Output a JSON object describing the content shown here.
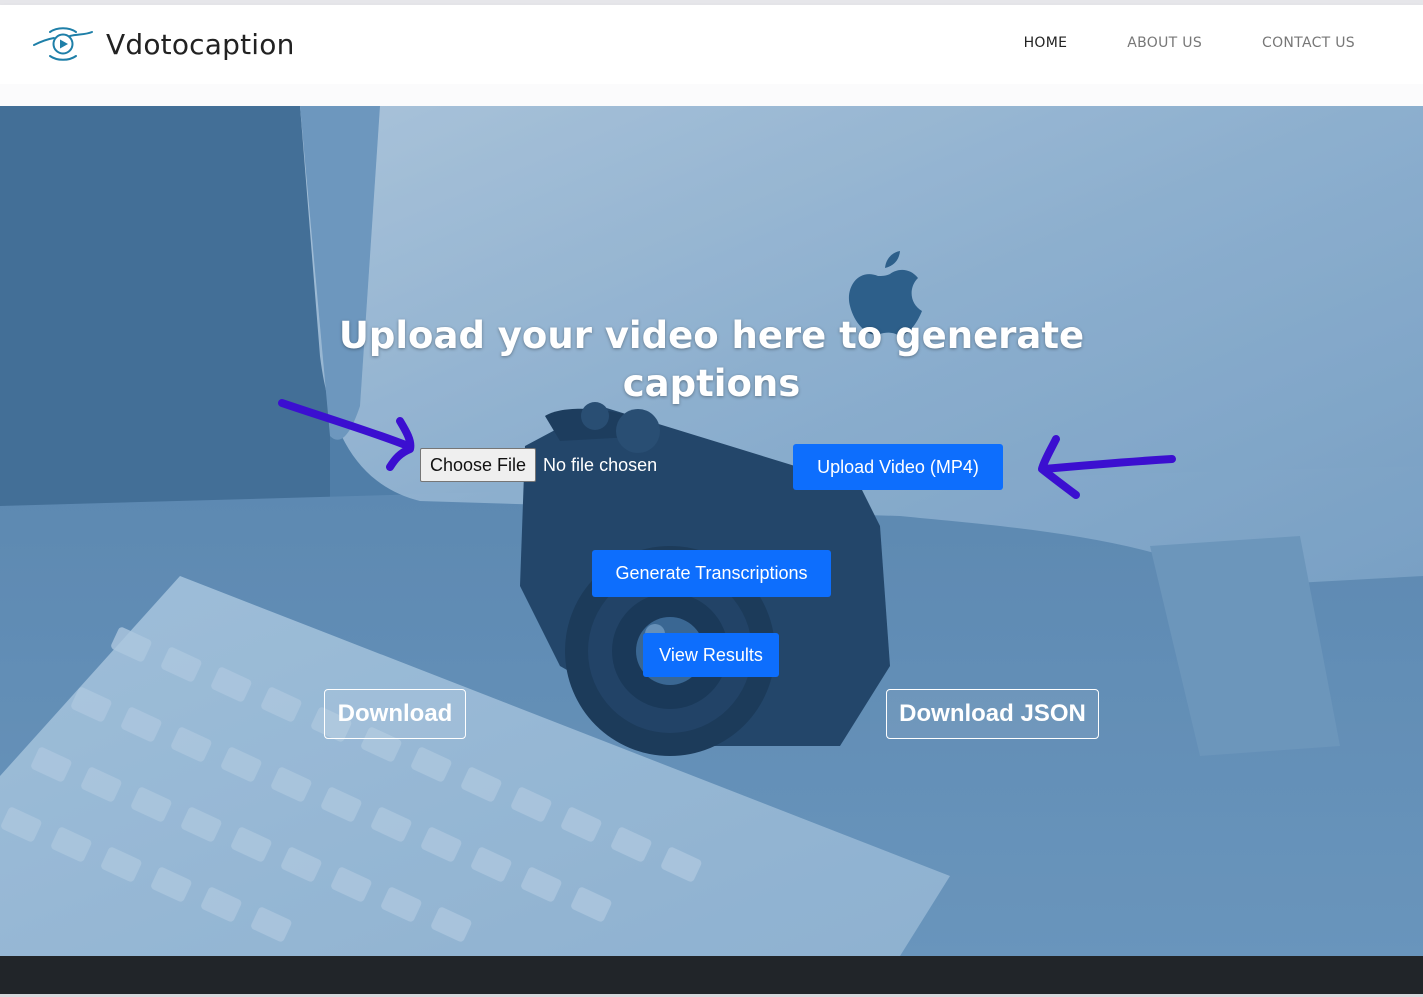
{
  "brand": {
    "name": "Vdotocaption",
    "logo_icon": "eye-play-logo-icon"
  },
  "nav": {
    "items": [
      {
        "label": "HOME",
        "active": true
      },
      {
        "label": "ABOUT US",
        "active": false
      },
      {
        "label": "CONTACT US",
        "active": false
      }
    ]
  },
  "hero": {
    "headline_line1": "Upload your video here to generate",
    "headline_line2": "captions",
    "file_input": {
      "button_label": "Choose File",
      "status": "No file chosen"
    },
    "upload_button": "Upload Video (MP4)",
    "generate_button": "Generate Transcriptions",
    "view_results_button": "View Results",
    "download_button": "Download",
    "download_json_button": "Download JSON"
  },
  "colors": {
    "primary": "#0d6efd",
    "footer": "#212529",
    "arrow": "#3b0fd0",
    "hero_tint": "#5b8db6"
  }
}
